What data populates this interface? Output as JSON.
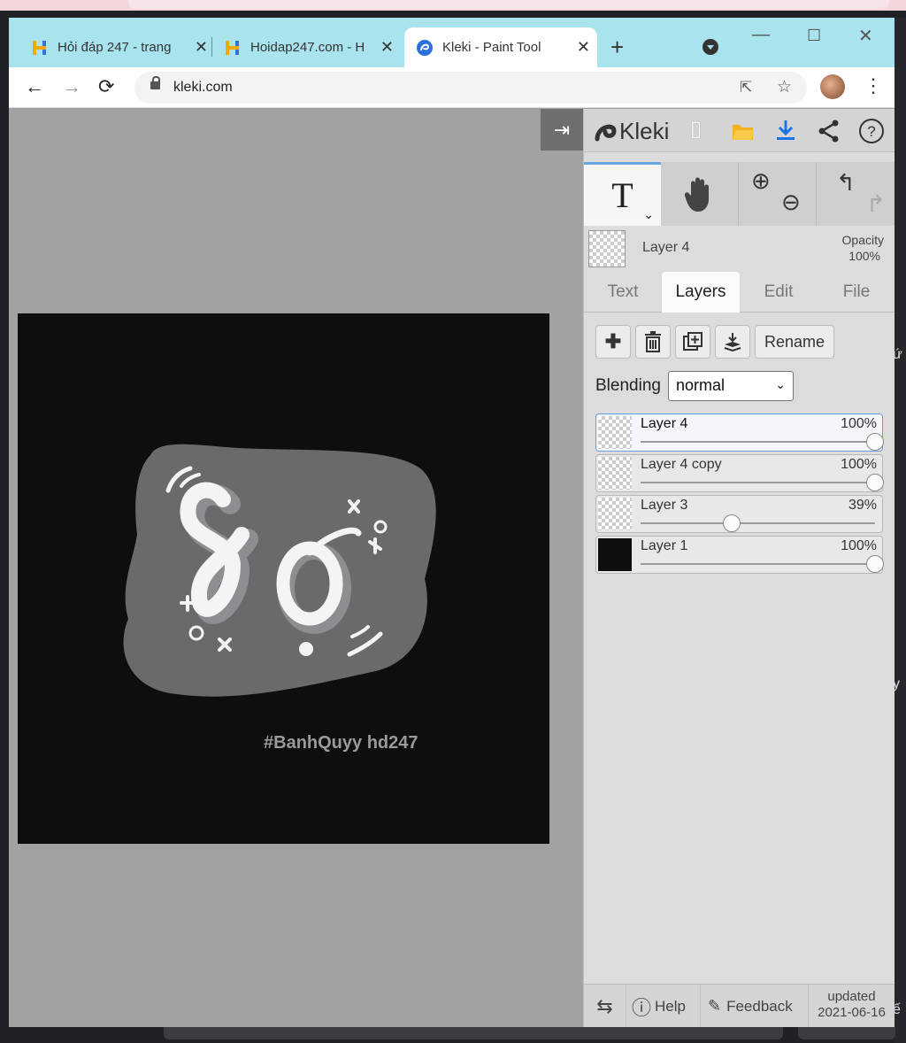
{
  "browser": {
    "tabs": [
      {
        "title": "Hỏi đáp 247 - trang",
        "active": false
      },
      {
        "title": "Hoidap247.com - H",
        "active": false
      },
      {
        "title": "Kleki - Paint Tool",
        "active": true
      }
    ],
    "address": "kleki.com"
  },
  "app": {
    "logo_text": "Kleki",
    "current_layer": {
      "name": "Layer 4",
      "opacity_label": "Opacity",
      "opacity_value": "100%"
    },
    "panel_tabs": [
      {
        "label": "Text",
        "active": false
      },
      {
        "label": "Layers",
        "active": true
      },
      {
        "label": "Edit",
        "active": false
      },
      {
        "label": "File",
        "active": false
      }
    ],
    "layer_buttons": {
      "rename": "Rename"
    },
    "blending": {
      "label": "Blending",
      "value": "normal"
    },
    "layers": [
      {
        "name": "Layer 4",
        "opacity": "100%",
        "fraction": 1.0,
        "selected": true
      },
      {
        "name": "Layer 4 copy",
        "opacity": "100%",
        "fraction": 1.0,
        "selected": false
      },
      {
        "name": "Layer 3",
        "opacity": "39%",
        "fraction": 0.39,
        "selected": false
      },
      {
        "name": "Layer 1",
        "opacity": "100%",
        "fraction": 1.0,
        "selected": false
      }
    ],
    "footer": {
      "help": "Help",
      "feedback": "Feedback",
      "updated_label": "updated",
      "updated_date": "2021-06-16"
    }
  },
  "canvas": {
    "text": "Sơ",
    "watermark": "#BanhQuyy     hd247"
  },
  "right_edge_glyphs": [
    "ứ",
    "y",
    "ế"
  ],
  "colors": {
    "tabbar": "#a9e3ee",
    "canvas_bg": "#0f0d0f",
    "workspace": "#a2a2a2",
    "accent_blue": "#1a73e8"
  }
}
